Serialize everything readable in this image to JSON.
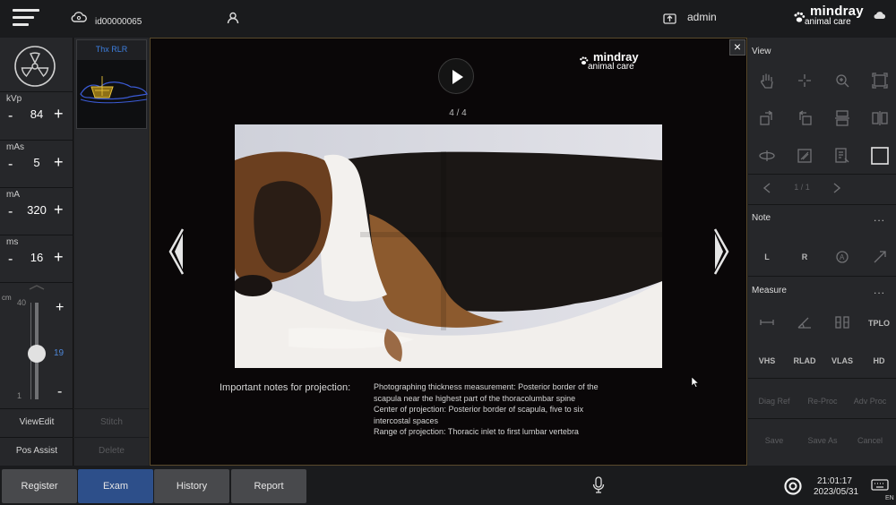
{
  "topbar": {
    "patient_id": "id00000065",
    "user": "admin",
    "brand_line1": "mindray",
    "brand_line2": "animal care"
  },
  "left_panel": {
    "params": [
      {
        "label": "kVp",
        "value": "84"
      },
      {
        "label": "mAs",
        "value": "5"
      },
      {
        "label": "mA",
        "value": "320"
      },
      {
        "label": "ms",
        "value": "16"
      }
    ],
    "slider": {
      "unit": "cm",
      "max": "40",
      "min": "1",
      "value": "19",
      "fraction": 0.47
    },
    "buttons": {
      "view_edit": "ViewEdit",
      "pos_assist": "Pos Assist"
    }
  },
  "thumb_column": {
    "thumb_label": "Thx RLR",
    "stitch": "Stitch",
    "delete": "Delete"
  },
  "viewer": {
    "brand_line1": "mindray",
    "brand_line2": "animal care",
    "counter": "4 / 4",
    "notes_label": "Important notes for projection:",
    "notes": [
      "Photographing thickness measurement: Posterior border of the",
      "scapula near the highest part of the thoracolumbar spine",
      "Center of projection: Posterior border of scapula, five to six",
      "intercostal spaces",
      "Range of projection: Thoracic inlet to first lumbar vertebra"
    ],
    "close_symbol": "×"
  },
  "right_panel": {
    "view_title": "View",
    "pager": "1 / 1",
    "note_title": "Note",
    "note_buttons": [
      "L",
      "R"
    ],
    "measure_title": "Measure",
    "measure_row1": [
      "TPLO"
    ],
    "measure_row2": [
      "VHS",
      "RLAD",
      "VLAS",
      "HD"
    ],
    "proc_buttons": [
      "Diag Ref",
      "Re-Proc",
      "Adv Proc"
    ],
    "save_buttons": [
      "Save",
      "Save As",
      "Cancel"
    ],
    "dots": "..."
  },
  "bottombar": {
    "tabs": [
      {
        "label": "Register",
        "active": false
      },
      {
        "label": "Exam",
        "active": true
      },
      {
        "label": "History",
        "active": false
      },
      {
        "label": "Report",
        "active": false
      }
    ],
    "time": "21:01:17",
    "date": "2023/05/31",
    "lang": "EN"
  }
}
